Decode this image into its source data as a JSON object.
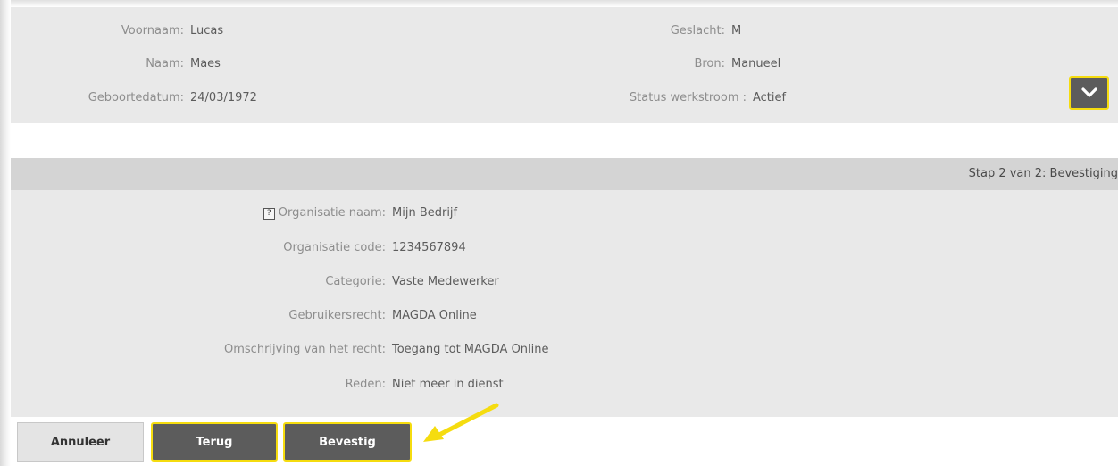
{
  "person": {
    "first_name_label": "Voornaam:",
    "first_name_value": "Lucas",
    "last_name_label": "Naam:",
    "last_name_value": "Maes",
    "birthdate_label": "Geboortedatum:",
    "birthdate_value": "24/03/1972",
    "gender_label": "Geslacht:",
    "gender_value": "M",
    "source_label": "Bron:",
    "source_value": "Manueel",
    "workflow_status_label": "Status werkstroom :",
    "workflow_status_value": "Actief",
    "expand_icon": "chevron-down-icon"
  },
  "step": {
    "label": "Stap 2 van 2: Bevestiging"
  },
  "details": {
    "help_icon_glyph": "?",
    "organisation_name_label": "Organisatie naam:",
    "organisation_name_value": "Mijn Bedrijf",
    "organisation_code_label": "Organisatie code:",
    "organisation_code_value": "1234567894",
    "category_label": "Categorie:",
    "category_value": "Vaste Medewerker",
    "user_right_label": "Gebruikersrecht:",
    "user_right_value": "MAGDA Online",
    "right_description_label": "Omschrijving van het recht:",
    "right_description_value": "Toegang tot MAGDA Online",
    "reason_label": "Reden:",
    "reason_value": "Niet meer in dienst"
  },
  "buttons": {
    "cancel_label": "Annuleer",
    "back_label": "Terug",
    "confirm_label": "Bevestig"
  },
  "colors": {
    "accent_border": "#f5dc0f",
    "button_dark": "#5c5c5c",
    "panel_background": "#e9e9e9",
    "annotation_arrow": "#f5dc0f"
  }
}
